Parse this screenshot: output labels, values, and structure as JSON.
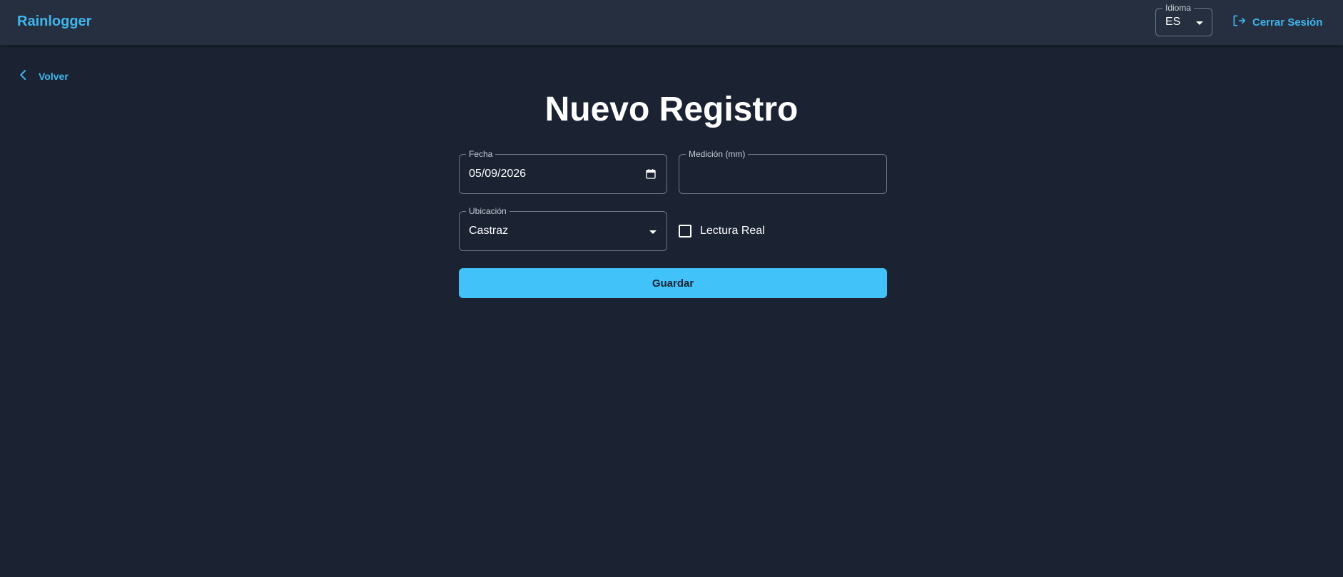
{
  "appbar": {
    "brand": "Rainlogger",
    "language": {
      "label": "Idioma",
      "value": "ES"
    },
    "logout": {
      "label": "Cerrar Sesión",
      "icon": "logout-icon"
    }
  },
  "nav": {
    "back_label": "Volver",
    "back_icon": "chevron-left-icon"
  },
  "page": {
    "title": "Nuevo Registro"
  },
  "form": {
    "fecha": {
      "label": "Fecha",
      "value": "05/09/2026",
      "icon": "calendar-icon"
    },
    "medicion": {
      "label": "Medición (mm)",
      "value": ""
    },
    "ubicacion": {
      "label": "Ubicación",
      "value": "Castraz"
    },
    "lectura_real": {
      "label": "Lectura Real",
      "checked": false
    },
    "submit_label": "Guardar"
  },
  "colors": {
    "accent": "#3fb6ec",
    "button": "#41c2f8",
    "background": "#1b2333",
    "appbar": "#262f40"
  }
}
